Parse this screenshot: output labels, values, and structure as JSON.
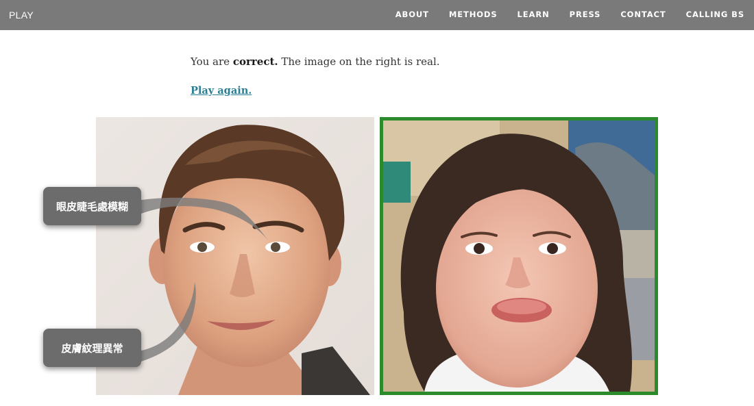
{
  "nav": {
    "brand": "PLAY",
    "links": [
      "ABOUT",
      "METHODS",
      "LEARN",
      "PRESS",
      "CONTACT",
      "CALLING BS"
    ]
  },
  "result": {
    "prefix": "You are ",
    "verdict": "correct.",
    "suffix": " The image on the right is real.",
    "play_again": "Play again."
  },
  "annotations": {
    "eyelash": "眼皮睫毛處模糊",
    "skin": "皮膚紋理異常"
  },
  "colors": {
    "navbar": "#7a7a7a",
    "link": "#2a7f94",
    "correct_border": "#2b8a2b",
    "callout": "#6c6c6c"
  }
}
